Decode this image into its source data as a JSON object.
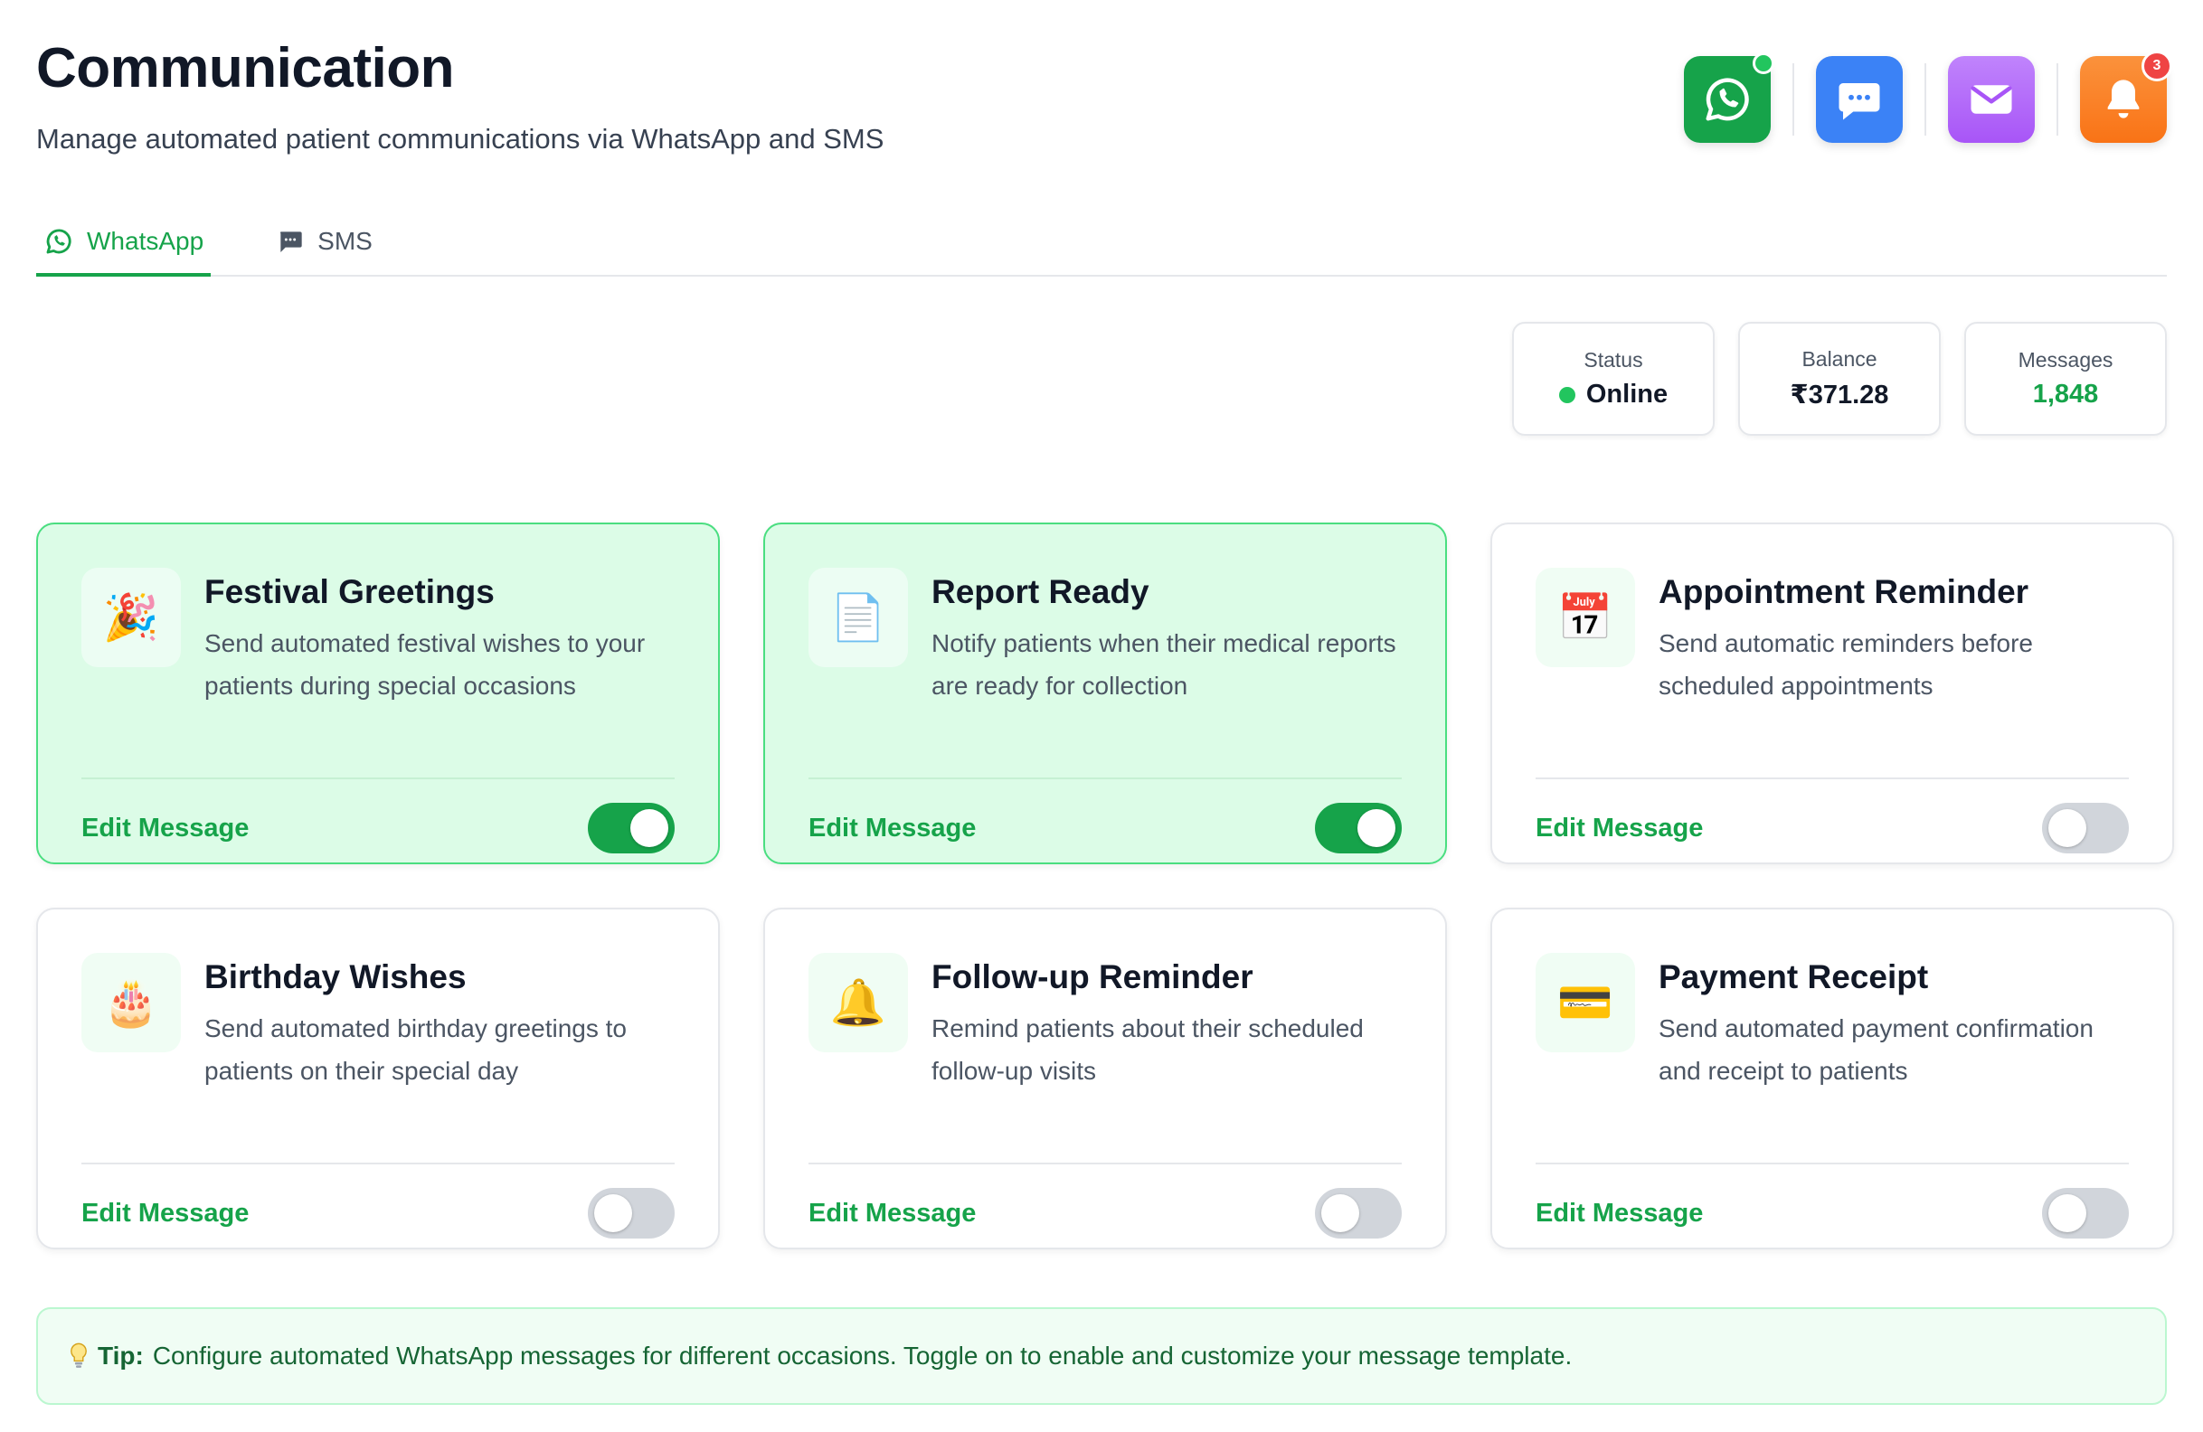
{
  "header": {
    "title": "Communication",
    "subtitle": "Manage automated patient communications via WhatsApp and SMS",
    "channel_icons": [
      "whatsapp-icon",
      "chat-bubble-icon",
      "mail-icon",
      "bell-icon"
    ],
    "notification_count": "3"
  },
  "tabs": [
    {
      "label": "WhatsApp",
      "icon": "whatsapp-icon",
      "active": true
    },
    {
      "label": "SMS",
      "icon": "message-square-icon",
      "active": false
    }
  ],
  "stats": {
    "status": {
      "label": "Status",
      "value": "Online"
    },
    "balance": {
      "label": "Balance",
      "value": "₹371.28"
    },
    "messages": {
      "label": "Messages",
      "value": "1,848"
    }
  },
  "cards": [
    {
      "title": "Festival Greetings",
      "description": "Send automated festival wishes to your patients during special occasions",
      "icon": "party-popper-icon",
      "glyph": "🎉",
      "edit_label": "Edit Message",
      "enabled": true
    },
    {
      "title": "Report Ready",
      "description": "Notify patients when their medical reports are ready for collection",
      "icon": "document-icon",
      "glyph": "📄",
      "edit_label": "Edit Message",
      "enabled": true
    },
    {
      "title": "Appointment Reminder",
      "description": "Send automatic reminders before scheduled appointments",
      "icon": "calendar-icon",
      "glyph": "📅",
      "edit_label": "Edit Message",
      "enabled": false
    },
    {
      "title": "Birthday Wishes",
      "description": "Send automated birthday greetings to patients on their special day",
      "icon": "birthday-cake-icon",
      "glyph": "🎂",
      "edit_label": "Edit Message",
      "enabled": false
    },
    {
      "title": "Follow-up Reminder",
      "description": "Remind patients about their scheduled follow-up visits",
      "icon": "bell-icon",
      "glyph": "🔔",
      "edit_label": "Edit Message",
      "enabled": false
    },
    {
      "title": "Payment Receipt",
      "description": "Send automated payment confirmation and receipt to patients",
      "icon": "credit-card-icon",
      "glyph": "💳",
      "edit_label": "Edit Message",
      "enabled": false
    }
  ],
  "tip": {
    "icon": "lightbulb-icon",
    "label": "Tip:",
    "text": "Configure automated WhatsApp messages for different occasions. Toggle on to enable and customize your message template."
  },
  "colors": {
    "accent": "#16a34a",
    "card_enabled_bg": "#dcfce7",
    "toggle_off": "#d1d5db"
  }
}
